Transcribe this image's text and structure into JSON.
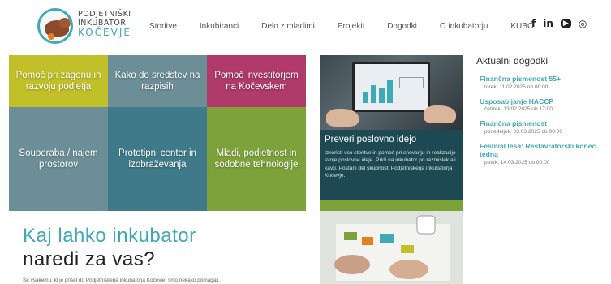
{
  "logo": {
    "line1": "PODJETNIŠKI",
    "line2": "INKUBATOR",
    "line3": "KOČEVJE"
  },
  "nav": [
    {
      "label": "Storitve"
    },
    {
      "label": "Inkubiranci"
    },
    {
      "label": "Delo z mladimi"
    },
    {
      "label": "Projekti"
    },
    {
      "label": "Dogodki"
    },
    {
      "label": "O inkubatorju"
    },
    {
      "label": "KUBO"
    }
  ],
  "social": {
    "facebook": "f",
    "linkedin": "in",
    "youtube": "▶",
    "instagram": "◎"
  },
  "tiles": [
    {
      "label": "Pomoč pri zagonu in razvoju podjetja",
      "color": "#c2c028"
    },
    {
      "label": "Kako do sredstev na razpisih",
      "color": "#6c8f97"
    },
    {
      "label": "Pomoč investitorjem na Kočevskem",
      "color": "#b03a6a"
    },
    {
      "label": "Souporaba / najem prostorov",
      "color": "#6c8f97"
    },
    {
      "label": "Prototipni center in izobraževanja",
      "color": "#3e7a8a"
    },
    {
      "label": "Mladi, podjetnost in sodobne tehnologije",
      "color": "#7ea23a"
    }
  ],
  "promo": {
    "title": "Preveri poslovno idejo",
    "text": "Izkoristi vse storitve in pomoč pri snovanju in realizacije svoje poslovne ideje. Pridi na inkubator po razmislek ali kavo. Postani del skupnosti Podjetniškega inkubatorja Kočevje."
  },
  "events": {
    "heading": "Aktualni dogodki",
    "items": [
      {
        "title": "Finančna pismenost 55+",
        "date": "torek, 11.02.2025 ob 00:00"
      },
      {
        "title": "Usposabljanje HACCP",
        "date": "četrtek, 13.02.2025 ob 17:00"
      },
      {
        "title": "Finančna pismenost",
        "date": "ponedeljek, 03.03.2025 ob 00:00"
      },
      {
        "title": "Festival lesa: Restavratorski konec tedna",
        "date": "petek, 14.03.2025 ob 00:00"
      }
    ]
  },
  "hero": {
    "line1": "Kaj lahko inkubator",
    "line2": "naredi za vas?",
    "sub": "Še vsakemu, ki je prišel do Podjetniškega inkubatorja Kočevje, smo nekako pomagali."
  },
  "colors": {
    "accent": "#3fa9b6",
    "promo_bg": "#1d4a52"
  }
}
